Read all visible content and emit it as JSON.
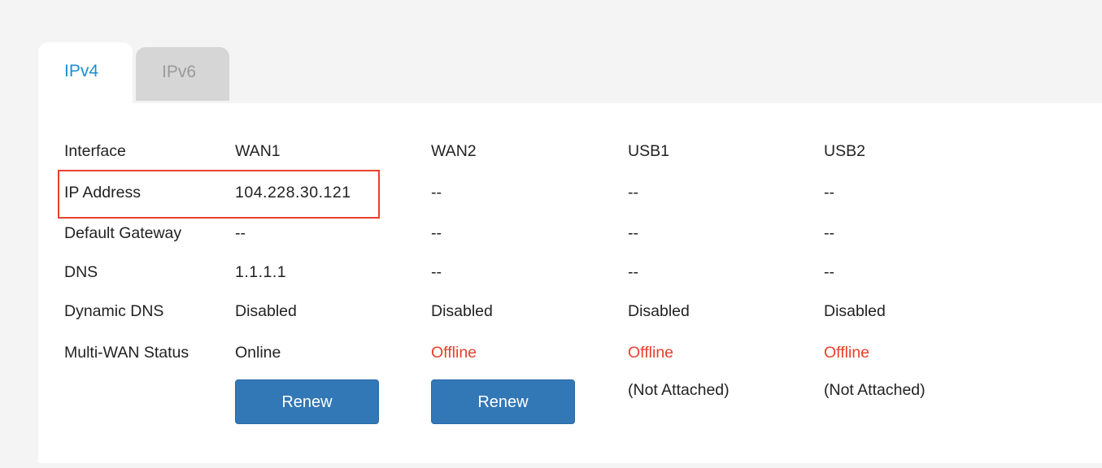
{
  "tabs": {
    "ipv4": "IPv4",
    "ipv6": "IPv6"
  },
  "table": {
    "rows": [
      {
        "label": "Interface",
        "values": [
          "WAN1",
          "WAN2",
          "USB1",
          "USB2"
        ]
      },
      {
        "label": "IP Address",
        "values": [
          "104.228.30.121",
          "--",
          "--",
          "--"
        ]
      },
      {
        "label": "Default Gateway",
        "values": [
          "--",
          "--",
          "--",
          "--"
        ]
      },
      {
        "label": "DNS",
        "values": [
          "1.1.1.1",
          "--",
          "--",
          "--"
        ]
      },
      {
        "label": "Dynamic DNS",
        "values": [
          "Disabled",
          "Disabled",
          "Disabled",
          "Disabled"
        ]
      },
      {
        "label": "Multi-WAN Status",
        "values": [
          "Online",
          "Offline",
          "Offline",
          "Offline"
        ]
      }
    ],
    "actions": {
      "wan1_button": "Renew",
      "wan2_button": "Renew",
      "usb1_status": "(Not Attached)",
      "usb2_status": "(Not Attached)"
    }
  },
  "colors": {
    "accent": "#1c8fd0",
    "offline": "#e8402b",
    "button": "#3277b6",
    "highlight_border": "#e8402b"
  }
}
